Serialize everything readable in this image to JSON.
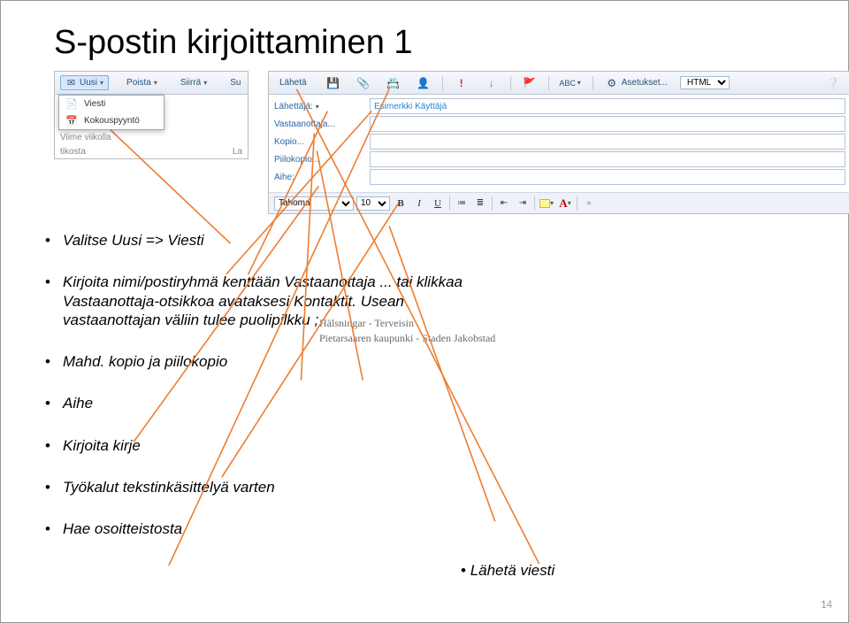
{
  "title": "S-postin kirjoittaminen 1",
  "shot_left": {
    "toolbar": {
      "uusi": "Uusi",
      "poista": "Poista",
      "siirra": "Siirrä"
    },
    "dropdown": {
      "viesti": "Viesti",
      "kokouspyynto": "Kokouspyyntö"
    },
    "tabs": {
      "postilaatikosta": "tikosta",
      "la": "La"
    },
    "frag": "Viime viikolla"
  },
  "shot_right": {
    "toolbar": {
      "laheta": "Lähetä",
      "asetukset": "Asetukset...",
      "html": "HTML"
    },
    "form": {
      "lahettaja_label": "Lähettäjä:",
      "lahettaja_value": "Esimerkki Käyttäjä",
      "vastaanottaja_label": "Vastaanottaja...",
      "kopio_label": "Kopio...",
      "piilokopio_label": "Piilokopio...",
      "aihe_label": "Aihe:"
    },
    "format": {
      "font": "Tahoma",
      "size": "10",
      "font_b": "B",
      "font_i": "I",
      "font_u": "U"
    },
    "watermark": {
      "row1": "Hälsningar - Terveisin",
      "row2": "Pietarsaaren kaupunki - Staden Jakobstad"
    }
  },
  "bullets": {
    "b1": "Valitse Uusi => Viesti",
    "b2": "Kirjoita nimi/postiryhmä kenttään Vastaanottaja ... tai klikkaa Vastaanottaja-otsikkoa avataksesi Kontaktit. Usean vastaanottajan väliin tulee puolipilkku ;",
    "b3": "Mahd. kopio ja piilokopio",
    "b4": "Aihe",
    "b5": "Kirjoita kirje",
    "b6": "Työkalut tekstinkäsittelyä varten",
    "b7": "Hae osoitteistosta",
    "bright": "Lähetä viesti"
  },
  "pagenum": "14"
}
